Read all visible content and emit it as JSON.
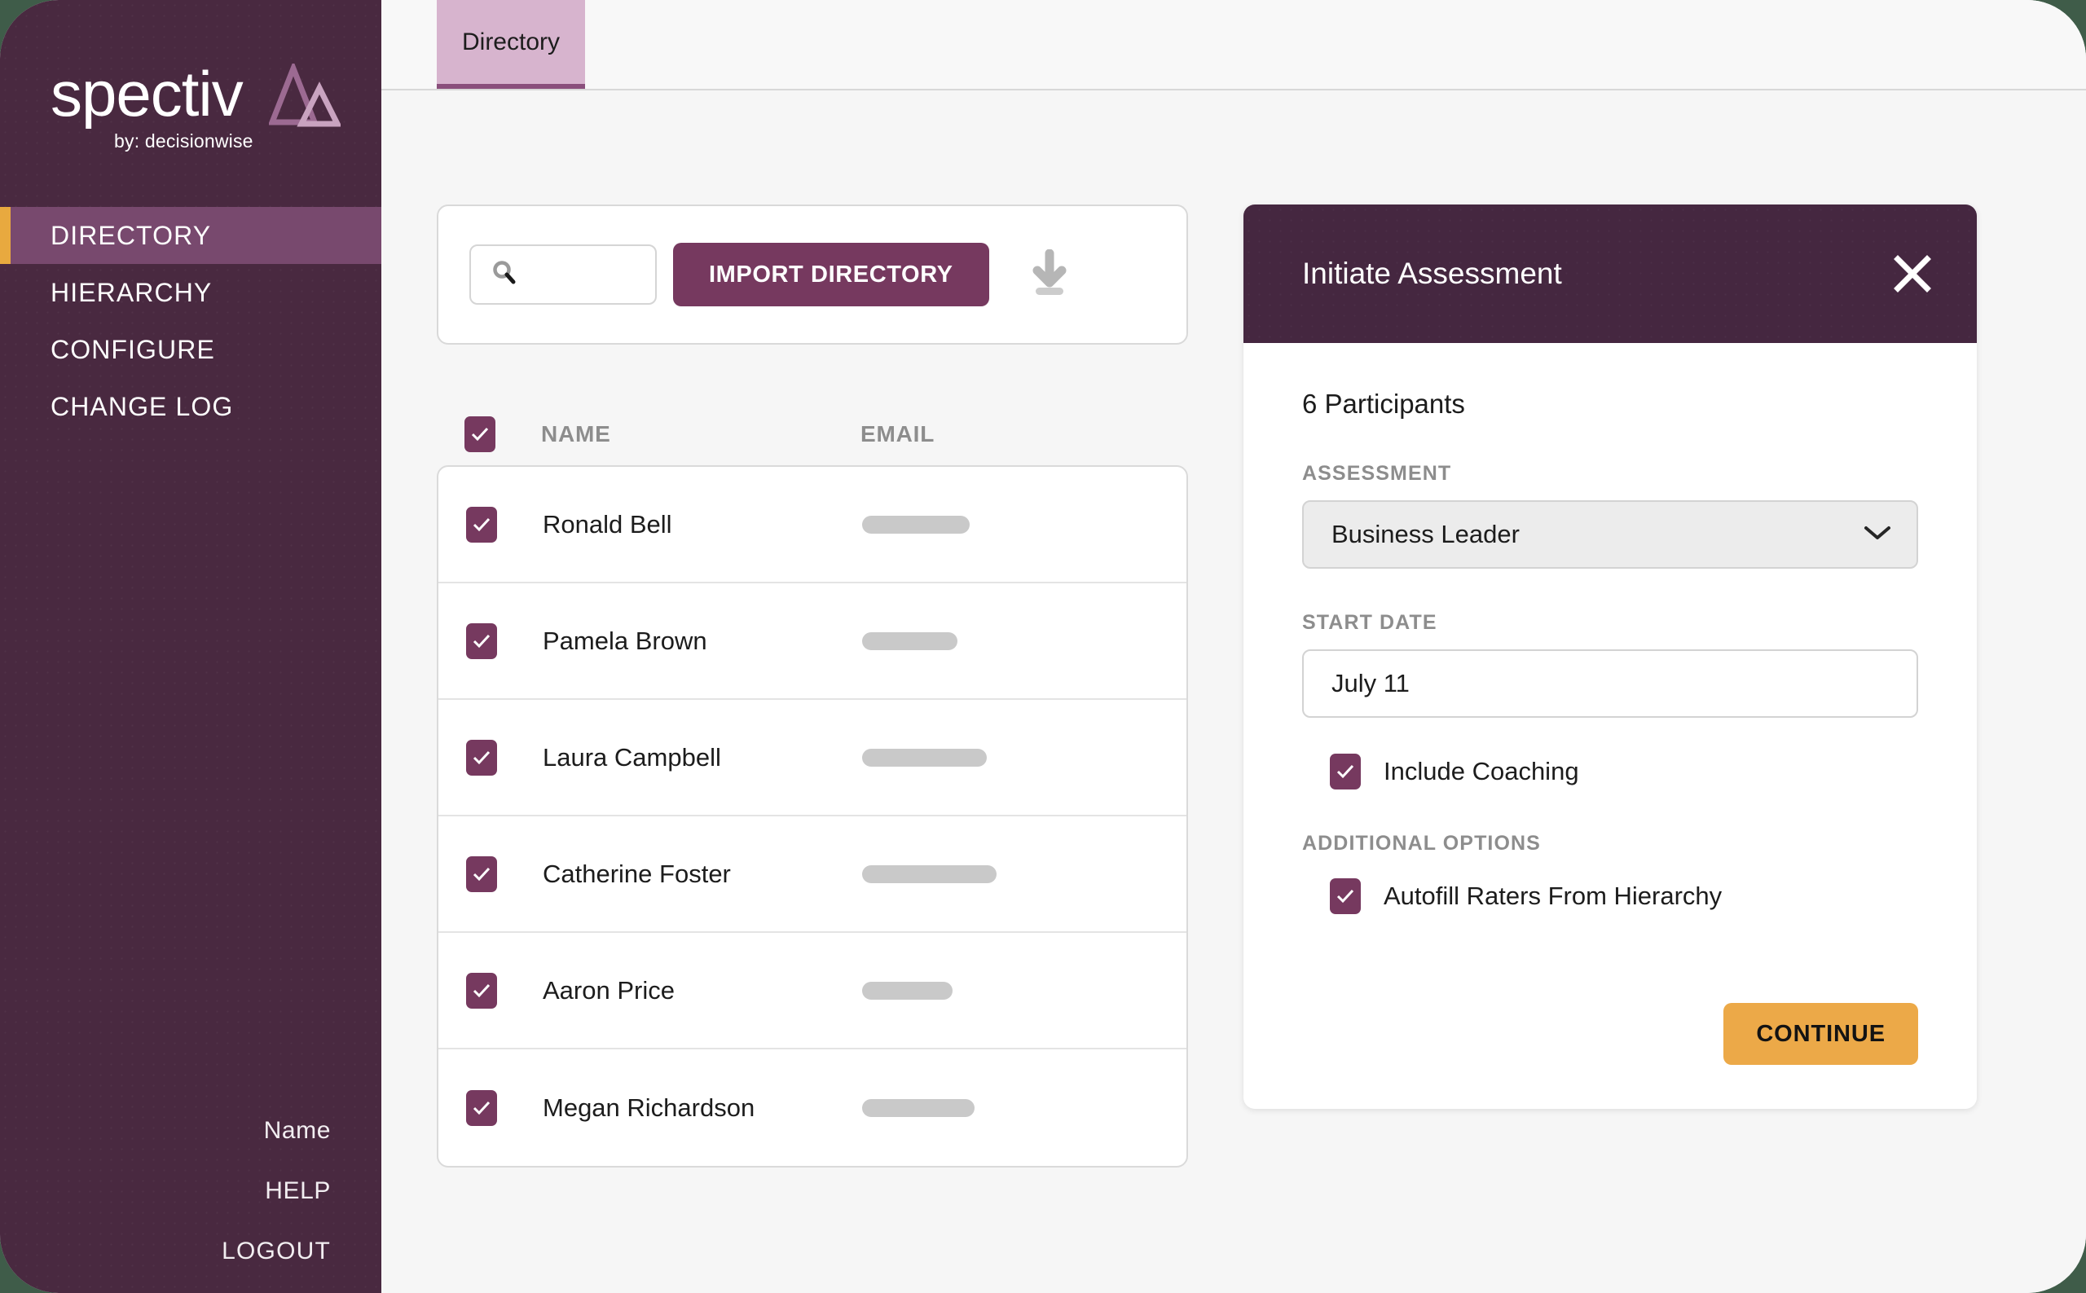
{
  "brand": {
    "name": "spectiv",
    "tagline": "by: decisionwise",
    "accent_orange": "#e8a93f",
    "sidebar_bg": "#492940",
    "active_bg": "#78496e",
    "purple": "#76395f"
  },
  "sidebar": {
    "items": [
      {
        "label": "DIRECTORY",
        "active": true
      },
      {
        "label": "HIERARCHY",
        "active": false
      },
      {
        "label": "CONFIGURE",
        "active": false
      },
      {
        "label": "CHANGE LOG",
        "active": false
      }
    ],
    "footer": [
      {
        "label": "Name"
      },
      {
        "label": "HELP"
      },
      {
        "label": "LOGOUT"
      }
    ]
  },
  "tabs": [
    {
      "label": "Directory",
      "active": true
    }
  ],
  "toolbar": {
    "search_value": "",
    "search_placeholder": "",
    "import_label": "IMPORT DIRECTORY",
    "download_icon": "download-icon",
    "search_icon": "search-icon"
  },
  "table": {
    "select_all_checked": true,
    "columns": [
      "NAME",
      "EMAIL"
    ],
    "rows": [
      {
        "checked": true,
        "name": "Ronald Bell",
        "email_width": 132
      },
      {
        "checked": true,
        "name": "Pamela Brown",
        "email_width": 117
      },
      {
        "checked": true,
        "name": "Laura Campbell",
        "email_width": 153
      },
      {
        "checked": true,
        "name": "Catherine Foster",
        "email_width": 165
      },
      {
        "checked": true,
        "name": "Aaron Price",
        "email_width": 111
      },
      {
        "checked": true,
        "name": "Megan Richardson",
        "email_width": 138
      }
    ]
  },
  "panel": {
    "title": "Initiate Assessment",
    "close_icon": "close-icon",
    "participants": "6 Participants",
    "assessment_label": "ASSESSMENT",
    "assessment_value": "Business Leader",
    "assessment_chevron": "chevron-down-icon",
    "start_date_label": "START DATE",
    "start_date_value": "July 11",
    "include_coaching_label": "Include Coaching",
    "include_coaching_checked": true,
    "additional_options_label": "ADDITIONAL OPTIONS",
    "autofill_label": "Autofill Raters From Hierarchy",
    "autofill_checked": true,
    "continue_label": "CONTINUE",
    "continue_color": "#eca948"
  }
}
